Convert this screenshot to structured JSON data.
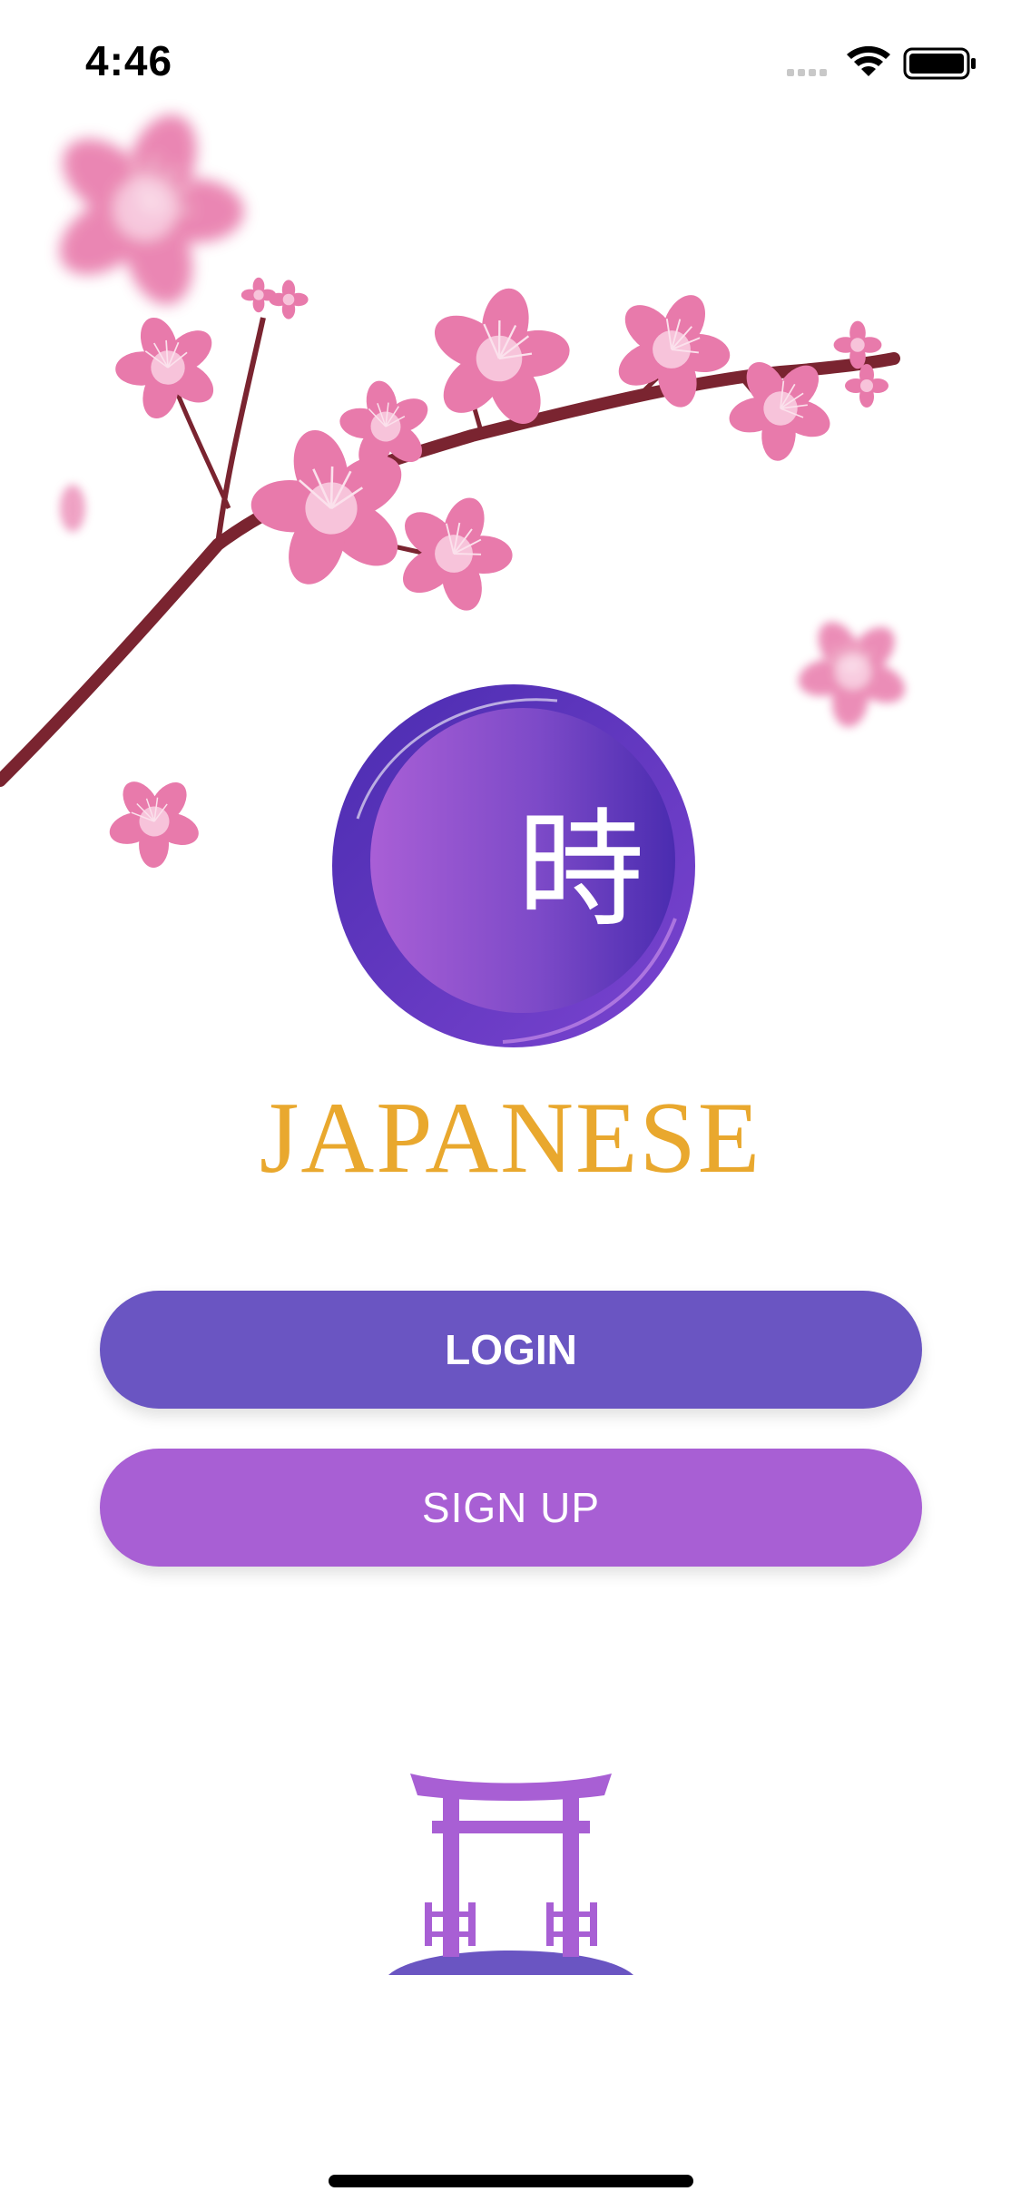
{
  "status_bar": {
    "time": "4:46"
  },
  "logo": {
    "kanji": "時",
    "icon": "kanji-badge-icon"
  },
  "brand": {
    "title": "JAPANESE"
  },
  "actions": {
    "login_label": "LOGIN",
    "signup_label": "SIGN UP"
  },
  "decor": {
    "branch_icon": "cherry-blossom-branch-icon",
    "torii_icon": "torii-gate-icon"
  },
  "colors": {
    "primary": "#6a55c2",
    "secondary": "#a85fd4",
    "brand_text": "#e9a82e",
    "blossom": "#e87aab",
    "branch": "#7a2430"
  }
}
